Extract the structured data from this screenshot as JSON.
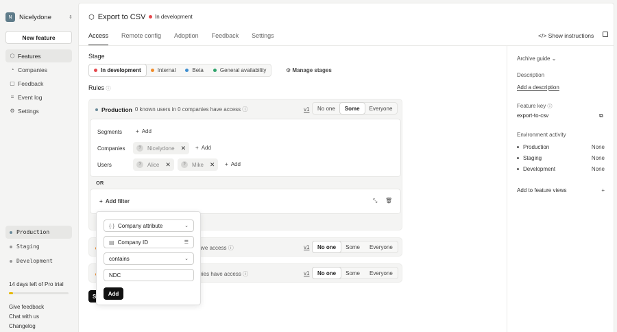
{
  "workspace": {
    "initial": "N",
    "name": "Nicelydone"
  },
  "sidebar": {
    "new_feature": "New feature",
    "items": [
      {
        "label": "Features",
        "icon": "cube-icon"
      },
      {
        "label": "Companies",
        "icon": "clock-icon"
      },
      {
        "label": "Feedback",
        "icon": "chat-icon"
      },
      {
        "label": "Event log",
        "icon": "list-icon"
      },
      {
        "label": "Settings",
        "icon": "gear-icon"
      }
    ],
    "environments": [
      "Production",
      "Staging",
      "Development"
    ],
    "trial_text": "14 days left of Pro trial",
    "trial_progress": 0.07,
    "footer": [
      "Give feedback",
      "Chat with us",
      "Changelog"
    ]
  },
  "header": {
    "title": "Export to CSV",
    "status": "In development",
    "show_instructions": "Show instructions"
  },
  "tabs": [
    "Access",
    "Remote config",
    "Adoption",
    "Feedback",
    "Settings"
  ],
  "stage": {
    "label": "Stage",
    "options": [
      {
        "label": "In development",
        "color": "#e5484d"
      },
      {
        "label": "Internal",
        "color": "#f08c2b"
      },
      {
        "label": "Beta",
        "color": "#3e8ed0"
      },
      {
        "label": "General availability",
        "color": "#30a46c"
      }
    ],
    "manage": "Manage stages"
  },
  "rules": {
    "label": "Rules",
    "production": {
      "name": "Production",
      "summary": "0 known users in 0 companies have access",
      "version": "v1"
    },
    "segment_options": [
      "No one",
      "Some",
      "Everyone"
    ],
    "segments_label": "Segments",
    "companies_label": "Companies",
    "users_label": "Users",
    "add": "Add",
    "company_chip": "Nicelydone",
    "user_chips": [
      "Alice",
      "Mike"
    ],
    "or": "OR",
    "add_filter": "Add filter",
    "staging_summary": "have access",
    "dev_summary": "anies have access",
    "version": "v1",
    "save": "S"
  },
  "popup": {
    "attribute_type": "Company attribute",
    "field": "Company ID",
    "operator": "contains",
    "value": "NDC",
    "add": "Add"
  },
  "right_panel": {
    "archive": "Archive guide",
    "description_label": "Description",
    "add_description": "Add a description",
    "feature_key_label": "Feature key",
    "feature_key": "export-to-csv",
    "env_activity_label": "Environment activity",
    "env_activity": [
      {
        "name": "Production",
        "value": "None"
      },
      {
        "name": "Staging",
        "value": "None"
      },
      {
        "name": "Development",
        "value": "None"
      }
    ],
    "add_views": "Add to feature views"
  }
}
